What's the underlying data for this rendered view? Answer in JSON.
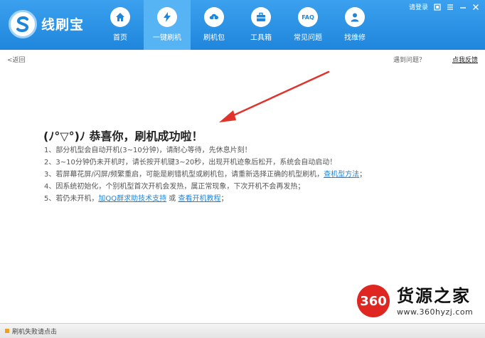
{
  "app": {
    "name": "线刷宝"
  },
  "nav": {
    "items": [
      {
        "label": "首页",
        "icon": "home-icon"
      },
      {
        "label": "一键刷机",
        "icon": "lightning-icon",
        "active": true
      },
      {
        "label": "刷机包",
        "icon": "cloud-download-icon"
      },
      {
        "label": "工具箱",
        "icon": "toolbox-icon"
      },
      {
        "label": "常见问题",
        "icon": "faq-icon",
        "badge": "FAQ"
      },
      {
        "label": "找维修",
        "icon": "user-icon"
      }
    ]
  },
  "topright": {
    "login": "请登录"
  },
  "subbar": {
    "back": "<返回",
    "problem": "遇到问题？",
    "feedback": "点我反馈"
  },
  "content": {
    "title": "(ﾉ°▽°)ﾉ 恭喜你，刷机成功啦！",
    "tips": [
      {
        "text": "1、部分机型会自动开机(3~10分钟)，请耐心等待，先休息片刻！"
      },
      {
        "text": "2、3~10分钟仍未开机时，请长按开机键3~20秒，出现开机迹象后松开，系统会自动启动！"
      },
      {
        "text": "3、若屏幕花屏/闪屏/频繁重启，可能是刷错机型或刷机包，请重新选择正确的机型刷机，",
        "link": "查机型方法",
        "tail": "；"
      },
      {
        "text": "4、因系统初始化，个别机型首次开机会发热，属正常现象，下次开机不会再发热；"
      },
      {
        "text": "5、若仍未开机，",
        "link": "加QQ群求助技术支持",
        "mid": " 或 ",
        "link2": "查看开机教程",
        "tail": "；"
      }
    ]
  },
  "watermark": {
    "badge": "360",
    "title": "货源之家",
    "url": "www.360hyzj.com"
  },
  "statusbar": {
    "text": "刷机失败请点击"
  },
  "colors": {
    "header": "#2a8fe4",
    "active_tab": "#56b4f5",
    "link": "#1e86dc",
    "arrow": "#e0332c"
  }
}
